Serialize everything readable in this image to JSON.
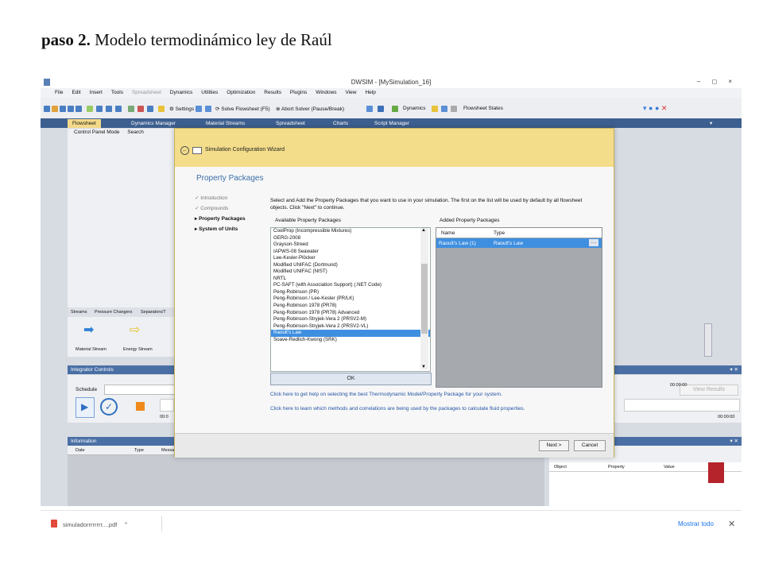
{
  "heading": {
    "bold": "paso 2.",
    "rest": " Modelo termodinámico ley de Raúl"
  },
  "window": {
    "title": "DWSIM - [MySimulation_16]",
    "controls": "– ◻ ×"
  },
  "menu": [
    "File",
    "Edit",
    "Insert",
    "Tools",
    "Spreadsheet",
    "Dynamics",
    "Utilities",
    "Optimization",
    "Results",
    "Plugins",
    "Windows",
    "View",
    "Help"
  ],
  "toolbar": {
    "settings": "Settings",
    "solve": "Solve Flowsheet (F5)",
    "abort": "Abort Solver (Pause/Break)",
    "dynamics": "Dynamics",
    "states": "Flowsheet States"
  },
  "tabs": [
    "Flowsheet",
    "Dynamics Manager",
    "Material Streams",
    "Spreadsheet",
    "Charts",
    "Script Manager"
  ],
  "control_panel": {
    "mode": "Control Panel Mode",
    "search": "Search"
  },
  "stream_tabs": [
    "Streams",
    "Pressure Changers",
    "Separators/T"
  ],
  "stream_icons": {
    "material": "Material Stream",
    "energy": "Energy Stream"
  },
  "integrator": {
    "title": "Integrator Controls",
    "schedule": "Schedule",
    "view_results": "View Results",
    "time1": "00:00:00",
    "time2": "00:00:00",
    "time_left": "00:0"
  },
  "information": {
    "title": "Information",
    "columns": [
      "Date",
      "Type",
      "Message"
    ]
  },
  "props": {
    "columns": [
      "Object",
      "Property",
      "Value"
    ]
  },
  "wizard": {
    "title": "Simulation Configuration Wizard",
    "heading": "Property Packages",
    "steps": [
      "✓ Introduction",
      "✓ Compounds",
      "▸ Property Packages",
      "▸ System of Units"
    ],
    "description": "Select and Add the Property Packages that you want to use in your simulation. The first on the list will be used by default by all flowsheet objects. Click \"Next\" to continue.",
    "available_label": "Available Property Packages",
    "added_label": "Added Property Packages",
    "available": [
      "CoolProp (Incompressible Mixtures)",
      "GERG-2008",
      "Grayson-Streed",
      "IAPWS-08 Seawater",
      "Lee-Kesler-Plöcker",
      "Modified UNIFAC (Dortmund)",
      "Modified UNIFAC (NIST)",
      "NRTL",
      "PC-SAFT (with Association Support) (.NET Code)",
      "Peng-Robinson (PR)",
      "Peng-Robinson / Lee-Kesler (PR/LK)",
      "Peng-Robinson 1978 (PR78)",
      "Peng-Robinson 1978 (PR78) Advanced",
      "Peng-Robinson-Stryjek-Vera 2 (PRSV2-M)",
      "Peng-Robinson-Stryjek-Vera 2 (PRSV2-VL)",
      "Raoult's Law",
      "Soave-Redlich-Kwong (SRK)"
    ],
    "selected_index": 15,
    "added_columns": [
      "Name",
      "Type"
    ],
    "added_rows": [
      {
        "name": "Raoult's Law (1)",
        "type": "Raoult's Law"
      }
    ],
    "ok": "OK",
    "help1": "Click here to get help on selecting the best Thermodynamic Model/Property Package for your system.",
    "help2": "Click here to learn which methods and correlations are being used by the packages to calculate fluid properties.",
    "next": "Next >",
    "cancel": "Cancel"
  },
  "download": {
    "file": "simuladorrrrrrrr....pdf",
    "show_all": "Mostrar todo"
  }
}
